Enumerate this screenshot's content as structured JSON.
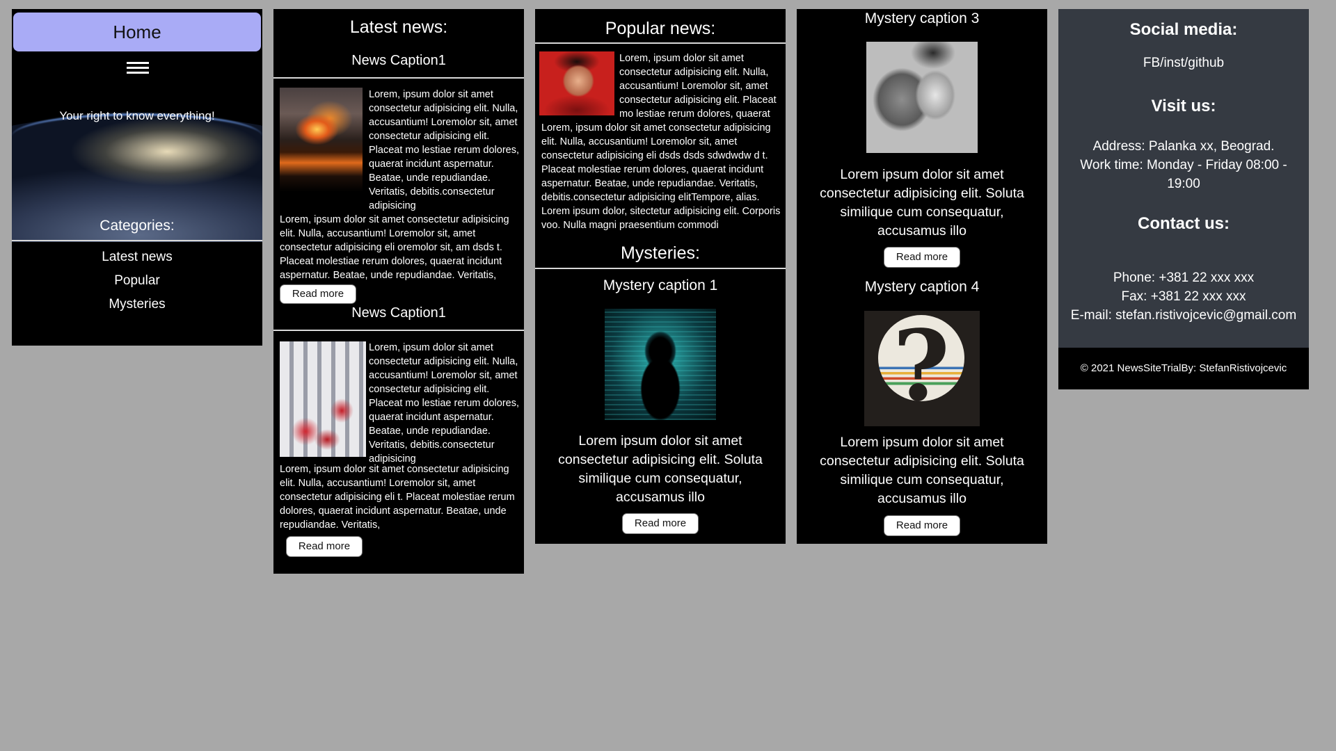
{
  "nav": {
    "home_label": "Home",
    "tagline": "Your right to know everything!",
    "categories_title": "Categories:",
    "categories": [
      {
        "label": "Latest news"
      },
      {
        "label": "Popular"
      },
      {
        "label": "Mysteries"
      }
    ]
  },
  "latest": {
    "title": "Latest news:",
    "articles": [
      {
        "caption": "News Caption1",
        "side_text": "Lorem, ipsum dolor sit amet consectetur adipisicing elit. Nulla, accusantium! Loremolor sit, amet consectetur adipisicing elit. Placeat mo lestiae rerum dolores, quaerat incidunt aspernatur. Beatae, unde repudiandae. Veritatis, debitis.consectetur adipisicing",
        "body_text": "Lorem, ipsum dolor sit amet consectetur adipisicing elit. Nulla, accusantium! Loremolor sit, amet consectetur adipisicing eli oremolor sit, am dsds t. Placeat molestiae rerum dolores, quaerat incidunt aspernatur. Beatae, unde repudiandae. Veritatis,",
        "button": "Read more",
        "image": "forest-fire-image"
      },
      {
        "caption": "News Caption1",
        "side_text": "Lorem, ipsum dolor sit amet consectetur adipisicing elit. Nulla, accusantium! Loremolor sit, amet consectetur adipisicing elit. Placeat mo lestiae rerum dolores, quaerat incidunt aspernatur. Beatae, unde repudiandae. Veritatis, debitis.consectetur adipisicing",
        "body_text": "Lorem, ipsum dolor sit amet consectetur adipisicing elit. Nulla, accusantium! Loremolor sit, amet consectetur adipisicing eli t. Placeat molestiae rerum dolores, quaerat incidunt aspernatur. Beatae, unde repudiandae. Veritatis,",
        "button": "Read more",
        "image": "protest-image"
      }
    ]
  },
  "popular": {
    "title": "Popular news:",
    "side_text": "Lorem, ipsum dolor sit amet consectetur adipisicing elit. Nulla, accusantium! Loremolor sit, amet consectetur adipisicing elit. Placeat mo lestiae rerum dolores, quaerat",
    "body_text": "Lorem, ipsum dolor sit amet consectetur adipisicing elit. Nulla, accusantium! Loremolor sit, amet consectetur adipisicing eli dsds  dsds sdwdwdw d t. Placeat molestiae rerum dolores, quaerat incidunt aspernatur. Beatae, unde repudiandae. Veritatis, debitis.consectetur adipisicing elitTempore, alias. Lorem ipsum dolor, sitectetur adipisicing elit. Corporis voo. Nulla magni praesentium commodi",
    "image": "elvis-portrait-image"
  },
  "mysteries": {
    "title": "Mysteries:",
    "items": [
      {
        "caption": "Mystery caption 1",
        "text": "Lorem ipsum dolor sit amet consectetur adipisicing elit. Soluta similique cum consequatur, accusamus illo",
        "button": "Read more",
        "image": "hooded-hacker-image"
      },
      {
        "caption": "Mystery caption 3",
        "text": "Lorem ipsum dolor sit amet consectetur adipisicing elit. Soluta similique cum consequatur, accusamus illo",
        "button": "Read more",
        "image": "girl-with-teddy-bear-image"
      },
      {
        "caption": "Mystery caption 4",
        "text": "Lorem ipsum dolor sit amet consectetur adipisicing elit. Soluta similique cum consequatur, accusamus illo",
        "button": "Read more",
        "image": "question-mark-image"
      }
    ]
  },
  "info": {
    "social_title": "Social media:",
    "social_links": "FB/inst/github",
    "visit_title": "Visit us:",
    "address": "Address: Palanka xx, Beograd.",
    "work_time": "Work time: Monday - Friday 08:00 - 19:00",
    "contact_title": "Contact us:",
    "phone": "Phone: +381 22 xxx xxx",
    "fax": "Fax: +381 22 xxx xxx",
    "email": "E-mail: stefan.ristivojcevic@gmail.com",
    "footer": "© 2021 NewsSiteTrialBy: StefanRistivojcevic"
  },
  "colors": {
    "page_background": "#a8a8a8",
    "panel_background": "#000000",
    "home_button": "#a9abf6",
    "info_panel": "#353a42"
  }
}
